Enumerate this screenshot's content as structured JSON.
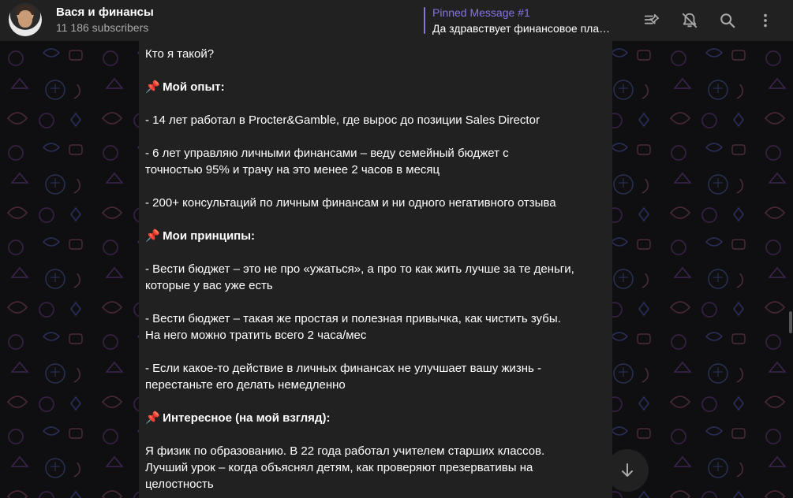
{
  "header": {
    "title": "Вася и финансы",
    "subscribers": "11 186 subscribers",
    "pinned_title": "Pinned Message #1",
    "pinned_text": "Да здравствует финансовое план...",
    "icons": [
      "pinned-list-icon",
      "mute-icon",
      "search-icon",
      "more-vertical-icon"
    ]
  },
  "message": {
    "lines": {
      "intro": "Кто я такой?",
      "pin": "📌",
      "h_experience": "Мой опыт:",
      "exp1": "- 14 лет работал в Procter&Gamble, где вырос до позиции Sales Director",
      "exp2a": "- 6 лет управляю личными финансами – веду семейный бюджет с",
      "exp2b": "точностью 95% и трачу на это менее 2 часов в месяц",
      "exp3": "- 200+ консультаций по личным финансам и ни одного негативного отзыва",
      "h_principles": "Мои принципы:",
      "pr1a": "- Вести бюджет – это не про «ужаться», а про то как жить лучше за те деньги,",
      "pr1b": "которые у вас уже есть",
      "pr2a": "- Вести бюджет – такая же простая и полезная привычка, как чистить зубы.",
      "pr2b": "На него можно тратить всего 2 часа/мес",
      "pr3a": "- Если какое-то действие в личных финансах не улучшает вашу жизнь -",
      "pr3b": "перестаньте его делать немедленно",
      "h_interesting": "Интересное (на мой взгляд):",
      "int1a": "Я физик по образованию. В 22 года работал учителем старших классов.",
      "int1b": "Лучший урок – когда объяснял детям, как проверяют презервативы на",
      "int1c": "целостность"
    }
  },
  "colors": {
    "accent": "#8774e1",
    "header_bg": "#212121",
    "bubble_bg": "#212121",
    "chat_bg": "#0f0f12"
  }
}
